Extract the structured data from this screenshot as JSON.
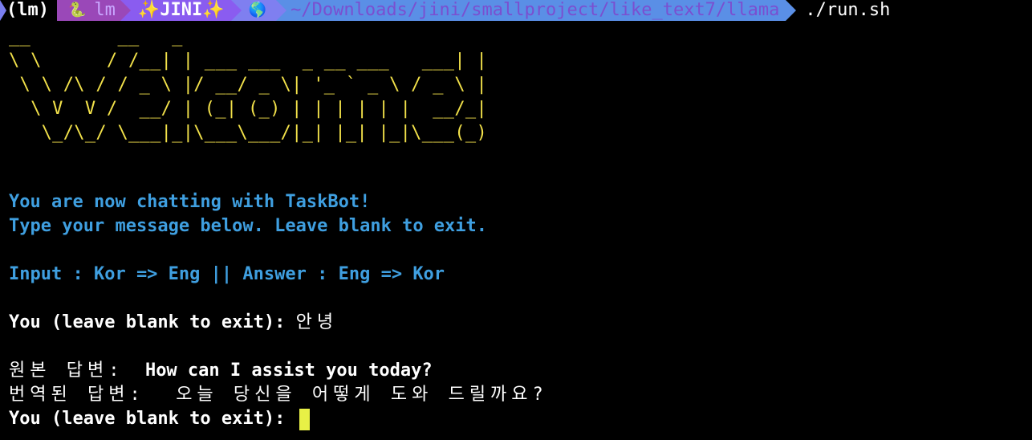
{
  "prompt": {
    "env": "(lm)",
    "python_icon": "🐍",
    "python_env": "lm",
    "sparkle": "✨",
    "name": "JINI",
    "os_icon": "🌎",
    "path": "~/Downloads/jini/smallproject/like_text7/llama",
    "command": "./run.sh"
  },
  "banner": "__        __   _\n\\ \\      / /__| | ___ ___  _ __ ___   ___| |\n \\ \\ /\\ / / _ \\ |/ __/ _ \\| '_ ` _ \\ / _ \\ |\n  \\ V  V /  __/ | (_| (_) | | | | | |  __/_|\n   \\_/\\_/ \\___|_|\\___\\___/|_| |_| |_|\\___(_)",
  "intro": {
    "line1": "You are now chatting with TaskBot!",
    "line2": "Type your message below. Leave blank to exit.",
    "mode": "Input : Kor => Eng || Answer : Eng => Kor"
  },
  "chat": {
    "prompt_label": "You (leave blank to exit): ",
    "user_message": "안녕",
    "original_label": "원본 답변:",
    "original_text": "  How can I assist you today?",
    "translated_label": "번역된 답변:",
    "translated_text": "  오늘 당신을 어떻게 도와 드릴까요?",
    "next_prompt_label": "You (leave blank to exit): "
  },
  "colors": {
    "background": "#000000",
    "banner": "#f2e14a",
    "info": "#3f9fe0",
    "cursor": "#e8f046"
  }
}
